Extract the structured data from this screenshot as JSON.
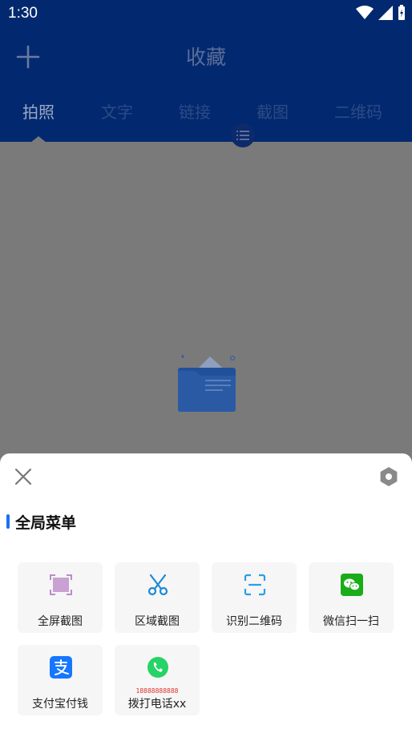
{
  "status_bar": {
    "time": "1:30"
  },
  "header": {
    "title": "收藏"
  },
  "tabs": [
    {
      "label": "拍照"
    },
    {
      "label": "文字"
    },
    {
      "label": "链接"
    },
    {
      "label": "截图"
    },
    {
      "label": "二维码"
    }
  ],
  "sheet": {
    "title": "全局菜单",
    "items": [
      {
        "label": "全屏截图",
        "icon": "fullscreen-screenshot-icon"
      },
      {
        "label": "区域截图",
        "icon": "scissors-icon"
      },
      {
        "label": "识别二维码",
        "icon": "qr-scan-icon"
      },
      {
        "label": "微信扫一扫",
        "icon": "wechat-icon"
      },
      {
        "label": "支付宝付钱",
        "icon": "alipay-icon"
      },
      {
        "label": "拨打电话xx",
        "icon": "phone-icon",
        "sublabel": "18888888888"
      }
    ]
  },
  "colors": {
    "accent": "#1b6ff0",
    "header_bg": "#02296f",
    "wechat": "#1aad19",
    "alipay": "#1677ff",
    "phone": "#25d366"
  }
}
